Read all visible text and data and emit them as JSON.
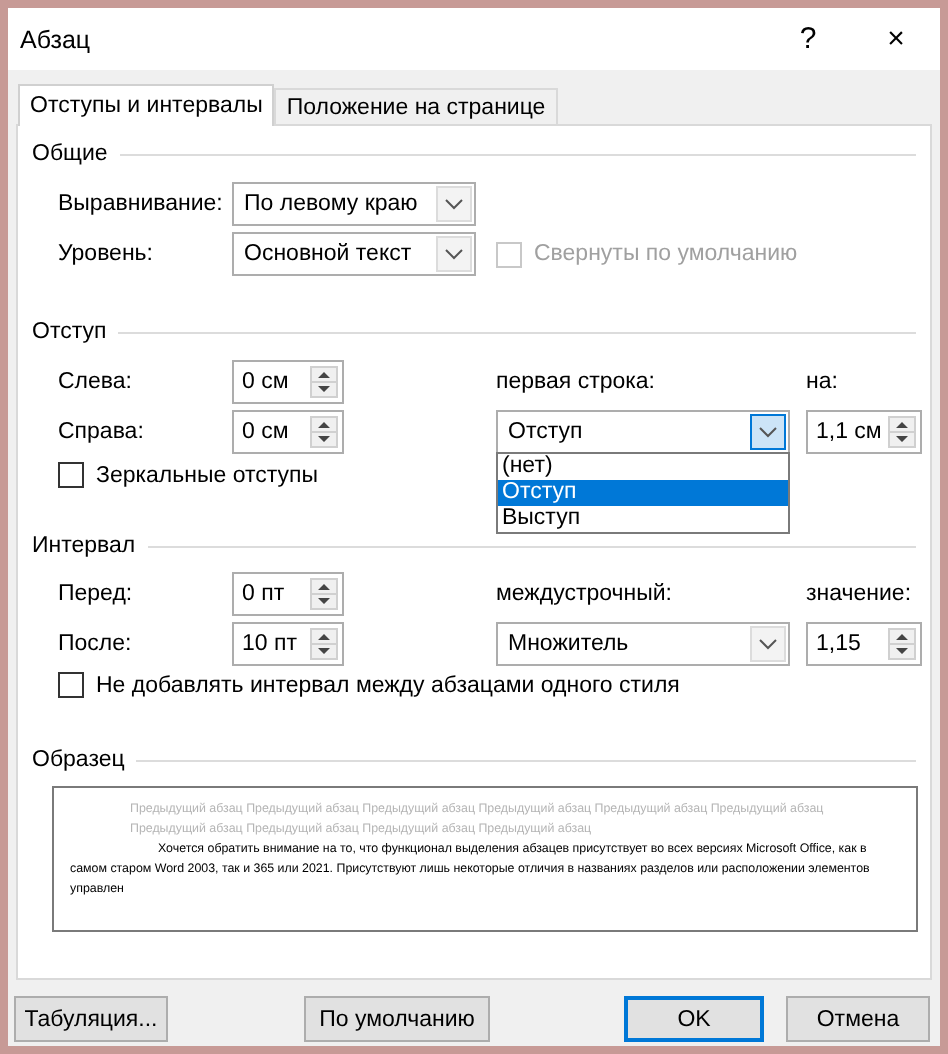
{
  "window": {
    "title": "Абзац",
    "help": "?",
    "close": "×"
  },
  "tabs": [
    {
      "label": "Отступы и интервалы",
      "selected": true
    },
    {
      "label": "Положение на странице",
      "selected": false
    }
  ],
  "general": {
    "heading": "Общие",
    "alignment": {
      "label": "Выравнивание:",
      "value": "По левому краю"
    },
    "level": {
      "label": "Уровень:",
      "value": "Основной текст"
    },
    "collapsed": {
      "label": "Свернуты по умолчанию",
      "checked": false,
      "disabled": true
    }
  },
  "indent": {
    "heading": "Отступ",
    "left": {
      "label": "Слева:",
      "value": "0 см"
    },
    "right": {
      "label": "Справа:",
      "value": "0 см"
    },
    "first_line": {
      "label": "первая строка:",
      "value": "Отступ",
      "expanded": true,
      "options": [
        {
          "label": "(нет)",
          "selected": false
        },
        {
          "label": "Отступ",
          "selected": true
        },
        {
          "label": "Выступ",
          "selected": false
        }
      ]
    },
    "by": {
      "label": "на:",
      "value": "1,1 см"
    },
    "mirror": {
      "label": "Зеркальные отступы",
      "checked": false,
      "disabled": false
    }
  },
  "spacing": {
    "heading": "Интервал",
    "before": {
      "label": "Перед:",
      "value": "0 пт"
    },
    "after": {
      "label": "После:",
      "value": "10 пт"
    },
    "line_spacing": {
      "label": "междустрочный:",
      "value": "Множитель",
      "expanded": false
    },
    "at": {
      "label": "значение:",
      "value": "1,15"
    },
    "no_space": {
      "label": "Не добавлять интервал между абзацами одного стиля",
      "checked": false,
      "disabled": false
    }
  },
  "preview": {
    "heading": "Образец",
    "previous": "Предыдущий абзац Предыдущий абзац Предыдущий абзац Предыдущий абзац Предыдущий абзац Предыдущий абзац Предыдущий абзац Предыдущий абзац Предыдущий абзац Предыдущий абзац",
    "sample": "Хочется обратить внимание на то, что функционал выделения абзацев присутствует во всех версиях Microsoft Office, как в самом старом Word 2003, так и 365 или 2021. Присутствуют лишь некоторые отличия в названиях разделов или расположении элементов управлен"
  },
  "buttons": [
    {
      "label": "Табуляция...",
      "default": false
    },
    {
      "label": "По умолчанию",
      "default": false
    },
    {
      "label": "OK",
      "default": true
    },
    {
      "label": "Отмена",
      "default": false
    }
  ]
}
